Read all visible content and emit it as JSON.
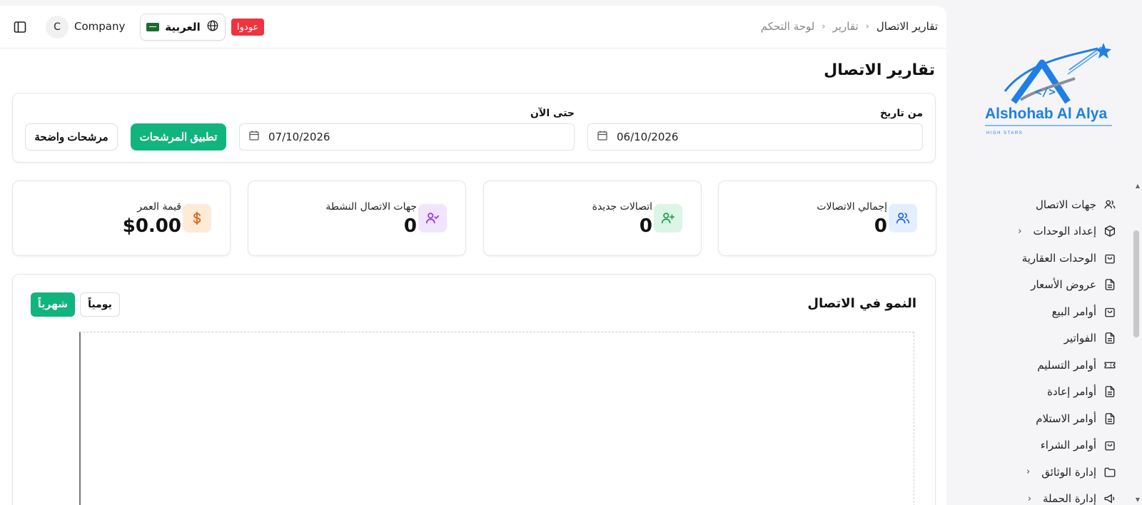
{
  "topbar": {
    "avatar_initial": "C",
    "company_name": "Company",
    "language_label": "العربية",
    "badge_label": "عودوا"
  },
  "breadcrumb": [
    "لوحة التحكم",
    "تقارير",
    "تقارير الاتصال"
  ],
  "page_title": "تقارير الاتصال",
  "filters": {
    "from_label": "من تاريخ",
    "from_value": "06/10/2026",
    "to_label": "حتى الآن",
    "to_value": "07/10/2026",
    "apply_label": "تطبيق المرشحات",
    "clear_label": "مرشحات واضحة"
  },
  "stats": [
    {
      "label": "إجمالي الاتصالات",
      "value": "0",
      "icon": "users-icon",
      "color": "#2563eb",
      "bg": "#e3eefe"
    },
    {
      "label": "اتصالات جديدة",
      "value": "0",
      "icon": "user-plus-icon",
      "color": "#16a34a",
      "bg": "#dcf5e4"
    },
    {
      "label": "جهات الاتصال النشطة",
      "value": "0",
      "icon": "user-check-icon",
      "color": "#9333ea",
      "bg": "#f1e4fd"
    },
    {
      "label": "قيمة العمر",
      "value": "$0.00",
      "icon": "dollar-icon",
      "color": "#ea580c",
      "bg": "#fdebd8"
    }
  ],
  "chart": {
    "title": "النمو في الاتصال",
    "daily_label": "يومياً",
    "monthly_label": "شهرياً"
  },
  "sidebar": {
    "brand": "Alshohab Al Alya",
    "tagline": "HIGH STARS",
    "items": [
      {
        "label": "جهات الاتصال",
        "icon": "users-icon"
      },
      {
        "label": "إعداد الوحدات",
        "icon": "box-icon",
        "expandable": true
      },
      {
        "label": "الوحدات العقارية",
        "icon": "bag-icon"
      },
      {
        "label": "عروض الأسعار",
        "icon": "file-icon"
      },
      {
        "label": "أوامر البيع",
        "icon": "bag-icon"
      },
      {
        "label": "الفواتير",
        "icon": "file-icon"
      },
      {
        "label": "أوامر التسليم",
        "icon": "ticket-icon"
      },
      {
        "label": "أوامر إعادة",
        "icon": "file-icon"
      },
      {
        "label": "أوامر الاستلام",
        "icon": "file-icon"
      },
      {
        "label": "أوامر الشراء",
        "icon": "bag-icon"
      },
      {
        "label": "إدارة الوثائق",
        "icon": "folder-icon",
        "expandable": true
      },
      {
        "label": "إدارة الحملة",
        "icon": "megaphone-icon",
        "expandable": true
      }
    ]
  },
  "colors": {
    "accent": "#12b47d",
    "badge": "#ef3340",
    "brand": "#1e7fe6"
  }
}
